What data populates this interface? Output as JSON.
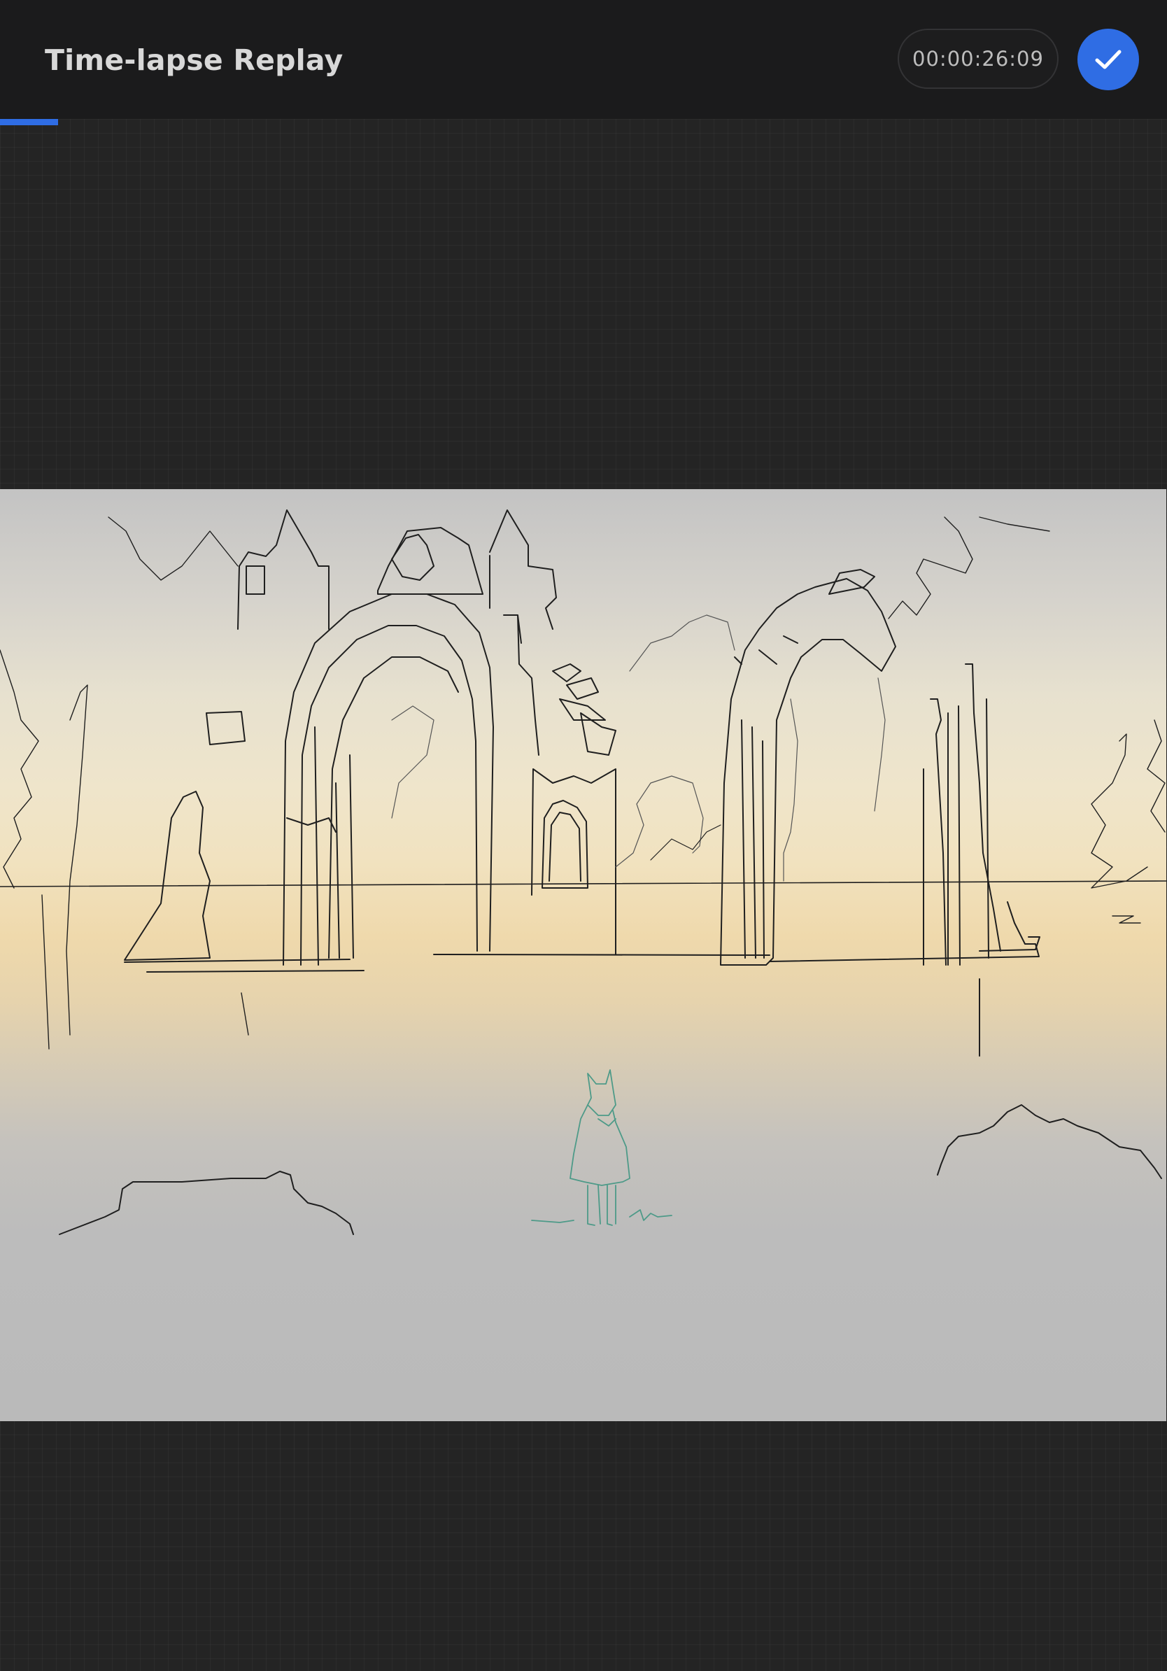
{
  "header": {
    "title": "Time-lapse Replay",
    "timecode": "00:00:26:09",
    "done_icon": "checkmark-icon"
  },
  "playback": {
    "progress_fraction": 0.05
  },
  "colors": {
    "accent": "#2f6de4",
    "topbar": "#1b1b1c",
    "background": "#242424",
    "sketch_line": "#1f1f1f",
    "figure_line": "#4d9a88"
  }
}
